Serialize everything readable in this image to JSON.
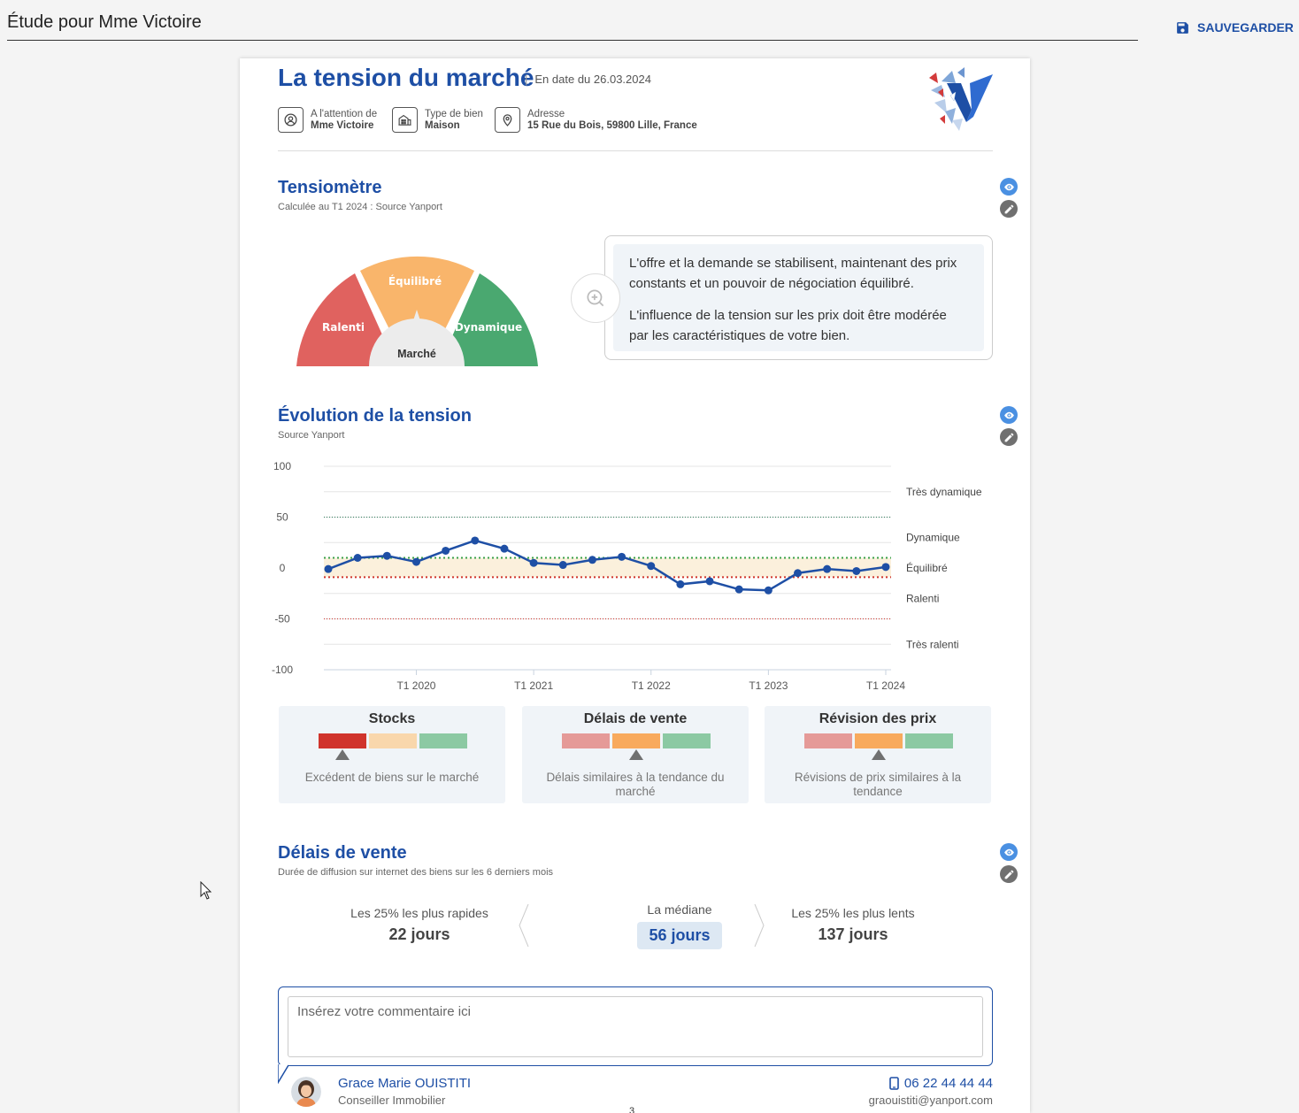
{
  "header": {
    "title_value": "Étude pour Mme Victoire",
    "save_label": "SAUVEGARDER"
  },
  "doc": {
    "title": "La tension du marché",
    "date": "En date du 26.03.2024",
    "meta": [
      {
        "label": "A l'attention de",
        "value": "Mme Victoire",
        "icon": "user-icon"
      },
      {
        "label": "Type de bien",
        "value": "Maison",
        "icon": "building-icon"
      },
      {
        "label": "Adresse",
        "value": "15 Rue du Bois, 59800 Lille, France",
        "icon": "location-pin-icon"
      }
    ]
  },
  "tensiometre": {
    "title": "Tensiomètre",
    "subtitle": "Calculée au T1 2024 : Source Yanport",
    "segments": [
      {
        "label": "Ralenti",
        "color": "#e0625f"
      },
      {
        "label": "Équilibré",
        "color": "#f9b56b"
      },
      {
        "label": "Dynamique",
        "color": "#4aa870"
      }
    ],
    "needle_label": "Marché",
    "text_1": "L'offre et la demande se stabilisent, maintenant des prix constants et un pouvoir de négociation équilibré.",
    "text_2": "L'influence de la tension sur les prix doit être modérée par les caractéristiques de votre bien."
  },
  "evolution": {
    "title": "Évolution de la tension",
    "subtitle": "Source Yanport"
  },
  "chart_data": {
    "type": "line",
    "title": "",
    "xlabel": "",
    "ylabel": "",
    "ylim": [
      -100,
      100
    ],
    "yticks": [
      100,
      50,
      0,
      -50,
      -100
    ],
    "x_tick_labels": [
      "T1 2020",
      "T1 2021",
      "T1 2022",
      "T1 2023",
      "T1 2024"
    ],
    "x_tick_indices": [
      3,
      7,
      11,
      15,
      19
    ],
    "zone_labels": [
      {
        "label": "Très dynamique",
        "y": 75
      },
      {
        "label": "Dynamique",
        "y": 30
      },
      {
        "label": "Équilibré",
        "y": 0
      },
      {
        "label": "Ralenti",
        "y": -30
      },
      {
        "label": "Très ralenti",
        "y": -75
      }
    ],
    "thresholds": [
      {
        "y": 50,
        "color": "#2e7d5b"
      },
      {
        "y": 10,
        "color": "#3aa14a"
      },
      {
        "y": -9,
        "color": "#d0342c"
      },
      {
        "y": -50,
        "color": "#d0342c"
      }
    ],
    "series": [
      {
        "values": [
          -1,
          10,
          12,
          6,
          17,
          27,
          19,
          5,
          3,
          8,
          11,
          2,
          -16,
          -13,
          -21,
          -22,
          -5,
          -1,
          -3,
          1
        ],
        "color": "#1e4fa5"
      }
    ],
    "grid": true
  },
  "indicators": [
    {
      "title": "Stocks",
      "desc": "Excédent de biens sur le marché",
      "colors": [
        "#d0342c",
        "#f9d7ac",
        "#8cc9a3"
      ],
      "position": 0
    },
    {
      "title": "Délais de vente",
      "desc": "Délais similaires à la tendance du marché",
      "colors": [
        "#e59a98",
        "#f8aa5d",
        "#8cc9a3"
      ],
      "position": 1
    },
    {
      "title": "Révision des prix",
      "desc": "Révisions de prix similaires à la tendance",
      "colors": [
        "#e59a98",
        "#f8aa5d",
        "#8cc9a3"
      ],
      "position": 1
    }
  ],
  "delais": {
    "title": "Délais de vente",
    "subtitle": "Durée de diffusion sur internet des biens sur les 6 derniers mois",
    "fast_label": "Les 25% les plus rapides",
    "fast_value": "22 jours",
    "median_label": "La médiane",
    "median_value": "56 jours",
    "slow_label": "Les 25% les plus lents",
    "slow_value": "137 jours"
  },
  "comment": {
    "placeholder": "Insérez votre commentaire ici"
  },
  "agent": {
    "name": "Grace Marie OUISTITI",
    "role": "Conseiller Immobilier",
    "phone": "06 22 44 44 44",
    "email": "graouistiti@yanport.com"
  },
  "page_number": "3",
  "colors": {
    "brand": "#1e4fa5",
    "eye_button": "#4a90e2",
    "pen_button": "#707070"
  }
}
